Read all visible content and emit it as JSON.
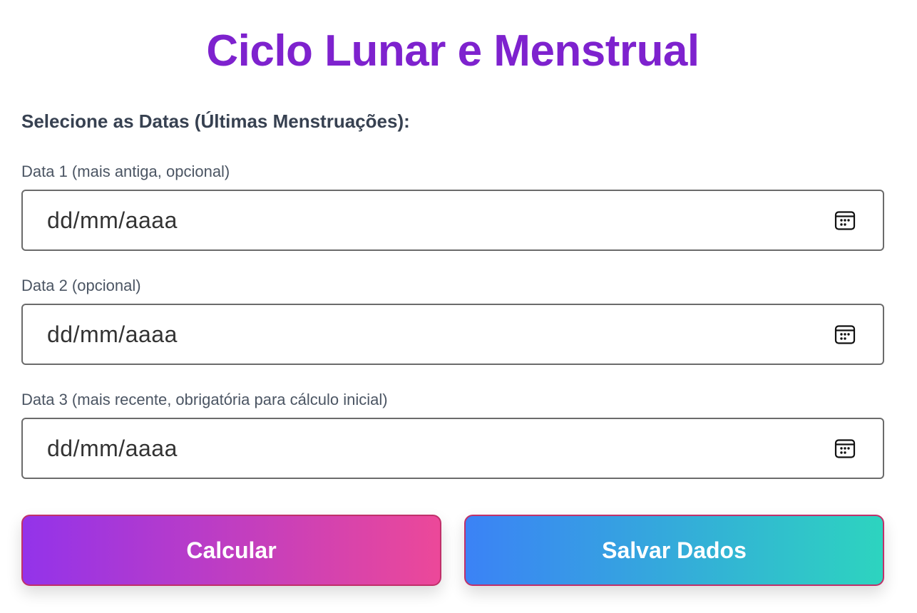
{
  "header": {
    "title": "Ciclo Lunar e Menstrual"
  },
  "form": {
    "section_heading": "Selecione as Datas (Últimas Menstruações):",
    "fields": [
      {
        "label": "Data 1 (mais antiga, opcional)",
        "placeholder": "dd/mm/aaaa",
        "icon": "calendar-icon"
      },
      {
        "label": "Data 2 (opcional)",
        "placeholder": "dd/mm/aaaa",
        "icon": "calendar-icon"
      },
      {
        "label": "Data 3 (mais recente, obrigatória para cálculo inicial)",
        "placeholder": "dd/mm/aaaa",
        "icon": "calendar-icon"
      }
    ]
  },
  "actions": {
    "calculate_label": "Calcular",
    "save_label": "Salvar Dados"
  },
  "colors": {
    "title": "#7e22ce",
    "calculate_gradient": [
      "#9333ea",
      "#ec4899"
    ],
    "save_gradient": [
      "#3b82f6",
      "#2dd4bf"
    ],
    "button_border": "#c0306a"
  }
}
